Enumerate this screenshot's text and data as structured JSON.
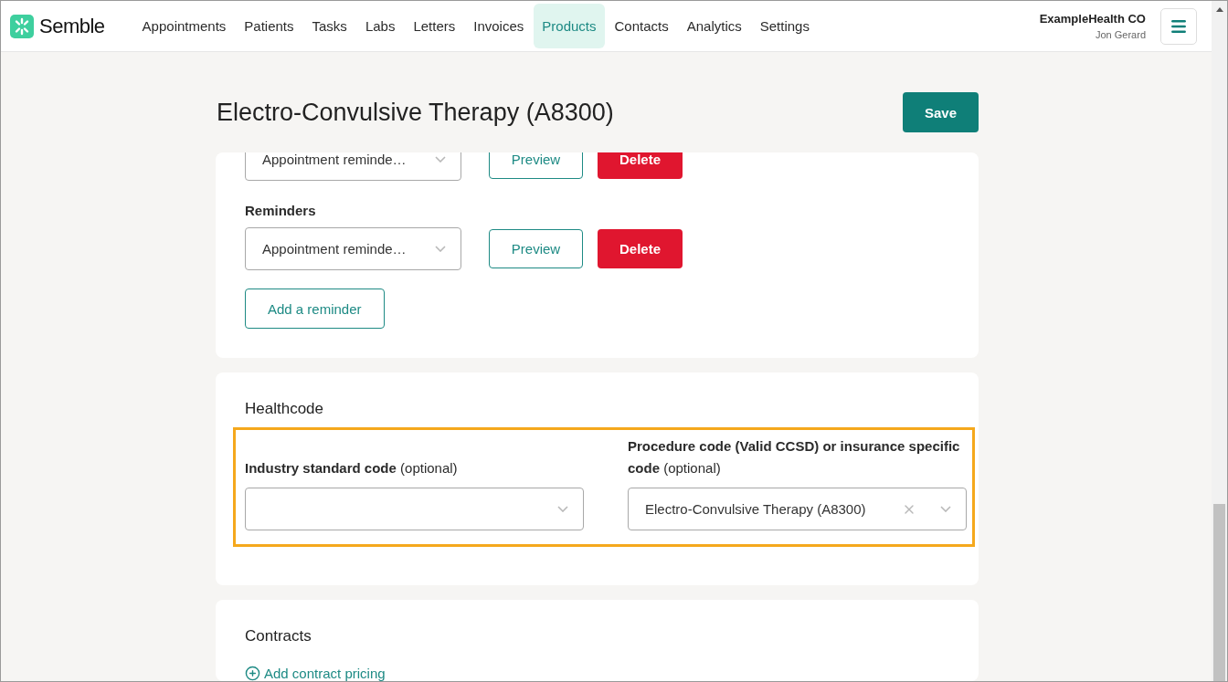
{
  "brand": {
    "name": "Semble"
  },
  "nav": [
    {
      "label": "Appointments",
      "selected": false
    },
    {
      "label": "Patients",
      "selected": false
    },
    {
      "label": "Tasks",
      "selected": false
    },
    {
      "label": "Labs",
      "selected": false
    },
    {
      "label": "Letters",
      "selected": false
    },
    {
      "label": "Invoices",
      "selected": false
    },
    {
      "label": "Products",
      "selected": true
    },
    {
      "label": "Contacts",
      "selected": false
    },
    {
      "label": "Analytics",
      "selected": false
    },
    {
      "label": "Settings",
      "selected": false
    }
  ],
  "account": {
    "organization": "ExampleHealth CO",
    "user": "Jon Gerard"
  },
  "title": "Electro-Convulsive Therapy (A8300)",
  "save_button": "Save",
  "reminders": {
    "rows": [
      {
        "value": "Appointment reminde…",
        "preview": "Preview",
        "delete": "Delete"
      },
      {
        "label": "Reminders",
        "value": "Appointment reminde…",
        "preview": "Preview",
        "delete": "Delete"
      }
    ],
    "add_button": "Add a reminder"
  },
  "healthcode": {
    "heading": "Healthcode",
    "highlighted": true,
    "fields": [
      {
        "label": "Industry standard code",
        "hint": "(optional)"
      },
      {
        "label": "Procedure code (Valid CCSD) or insurance specific code",
        "hint": "(optional)",
        "value": "Electro-Convulsive Therapy (A8300)"
      }
    ]
  },
  "contracts": {
    "heading": "Contracts",
    "add_link": "Add contract pricing"
  }
}
